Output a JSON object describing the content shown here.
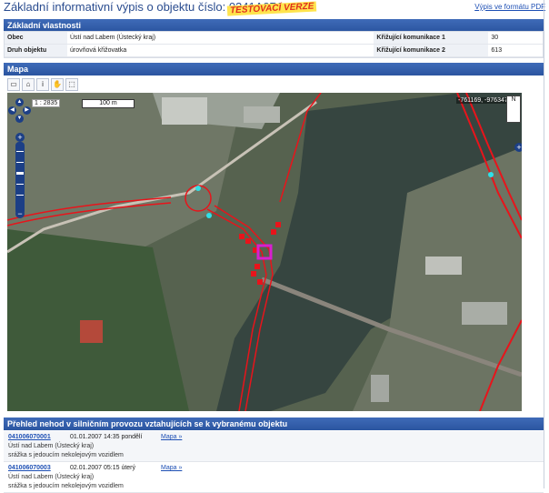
{
  "header": {
    "title": "Základní informativní výpis o objektu číslo: 0241A071",
    "badge": "TESTOVACÍ VERZE",
    "pdf_link": "Výpis ve formátu PDF"
  },
  "properties": {
    "section_title": "Základní vlastnosti",
    "rows": [
      {
        "label1": "Obec",
        "value1": "Ústí nad Labem (Ústecký kraj)",
        "label2": "Křižující komunikace 1",
        "value2": "30"
      },
      {
        "label1": "Druh objektu",
        "value1": "úrovňová křižovatka",
        "label2": "Křižující komunikace 2",
        "value2": "613"
      }
    ]
  },
  "map": {
    "section_title": "Mapa",
    "scale_ratio": "1 : 2835",
    "scale_bar": "100 m",
    "coordinates": "-761169, -976347",
    "north": "N",
    "colors": {
      "route": "#e8141b",
      "marker": "#d81fd0",
      "river": "#3b4b45"
    }
  },
  "accidents": {
    "section_title": "Přehled nehod v silničním provozu vztahujících se k vybranému objektu",
    "items": [
      {
        "id": "041006070001",
        "datetime": "01.01.2007 14:35 pondělí",
        "place": "Ústí nad Labem (Ústecký kraj)",
        "desc": "srážka s jedoucím nekolejovým vozidlem",
        "map_link": "Mapa »"
      },
      {
        "id": "041006070003",
        "datetime": "02.01.2007 05:15 úterý",
        "place": "Ústí nad Labem (Ústecký kraj)",
        "desc": "srážka s jedoucím nekolejovým vozidlem",
        "map_link": "Mapa »"
      }
    ]
  }
}
